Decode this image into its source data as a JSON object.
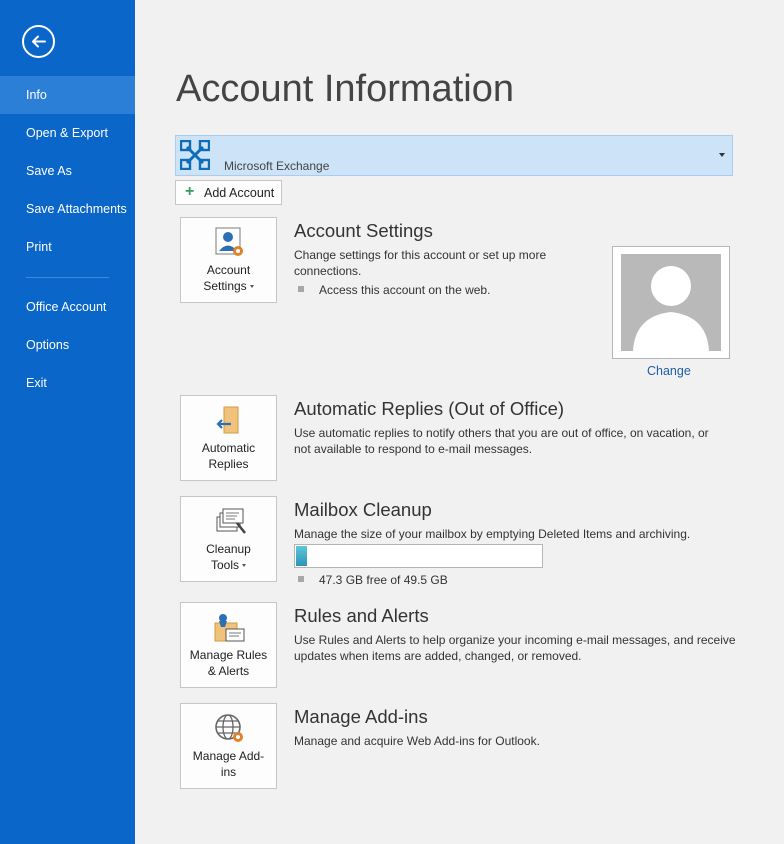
{
  "sidebar": {
    "back_icon": "back-arrow-icon",
    "items": [
      {
        "label": "Info",
        "active": true
      },
      {
        "label": "Open & Export"
      },
      {
        "label": "Save As"
      },
      {
        "label": "Save Attachments"
      },
      {
        "label": "Print"
      },
      {
        "label": "Office Account"
      },
      {
        "label": "Options"
      },
      {
        "label": "Exit"
      }
    ]
  },
  "main": {
    "title": "Account Information",
    "account_selector": {
      "value": "Microsoft Exchange",
      "icon": "exchange-icon"
    },
    "add_account_label": "Add Account",
    "sections": {
      "account_settings": {
        "tile_label_1": "Account",
        "tile_label_2": "Settings",
        "title": "Account Settings",
        "desc_line1": "Change settings for this account or set up more",
        "desc_line2": "connections.",
        "bullet": "Access this account on the web.",
        "change_photo_label": "Change"
      },
      "automatic_replies": {
        "tile_label_1": "Automatic",
        "tile_label_2": "Replies",
        "title": "Automatic Replies (Out of Office)",
        "desc_line1": "Use automatic replies to notify others that you are out of office, on vacation, or",
        "desc_line2": "not available to respond to e-mail messages."
      },
      "mailbox_cleanup": {
        "tile_label_1": "Cleanup",
        "tile_label_2": "Tools",
        "title": "Mailbox Cleanup",
        "desc_line1": "Manage the size of your mailbox by emptying Deleted Items and archiving.",
        "storage_text": "47.3 GB free of 49.5 GB",
        "used_fraction": 0.044
      },
      "rules_alerts": {
        "tile_label_1": "Manage Rules",
        "tile_label_2": "& Alerts",
        "title": "Rules and Alerts",
        "desc_line1": "Use Rules and Alerts to help organize your incoming e-mail messages, and receive",
        "desc_line2": "updates when items are added, changed, or removed."
      },
      "addins": {
        "tile_label_1": "Manage Add-",
        "tile_label_2": "ins",
        "title": "Manage Add-ins",
        "desc_line1": "Manage and acquire Web Add-ins for Outlook."
      }
    }
  },
  "colors": {
    "sidebar_bg": "#0a66c8",
    "sidebar_active": "#2b7fd6",
    "selector_bg": "#cde3f7",
    "link": "#1f5ea8",
    "progress_fill": "#2a95b6"
  }
}
